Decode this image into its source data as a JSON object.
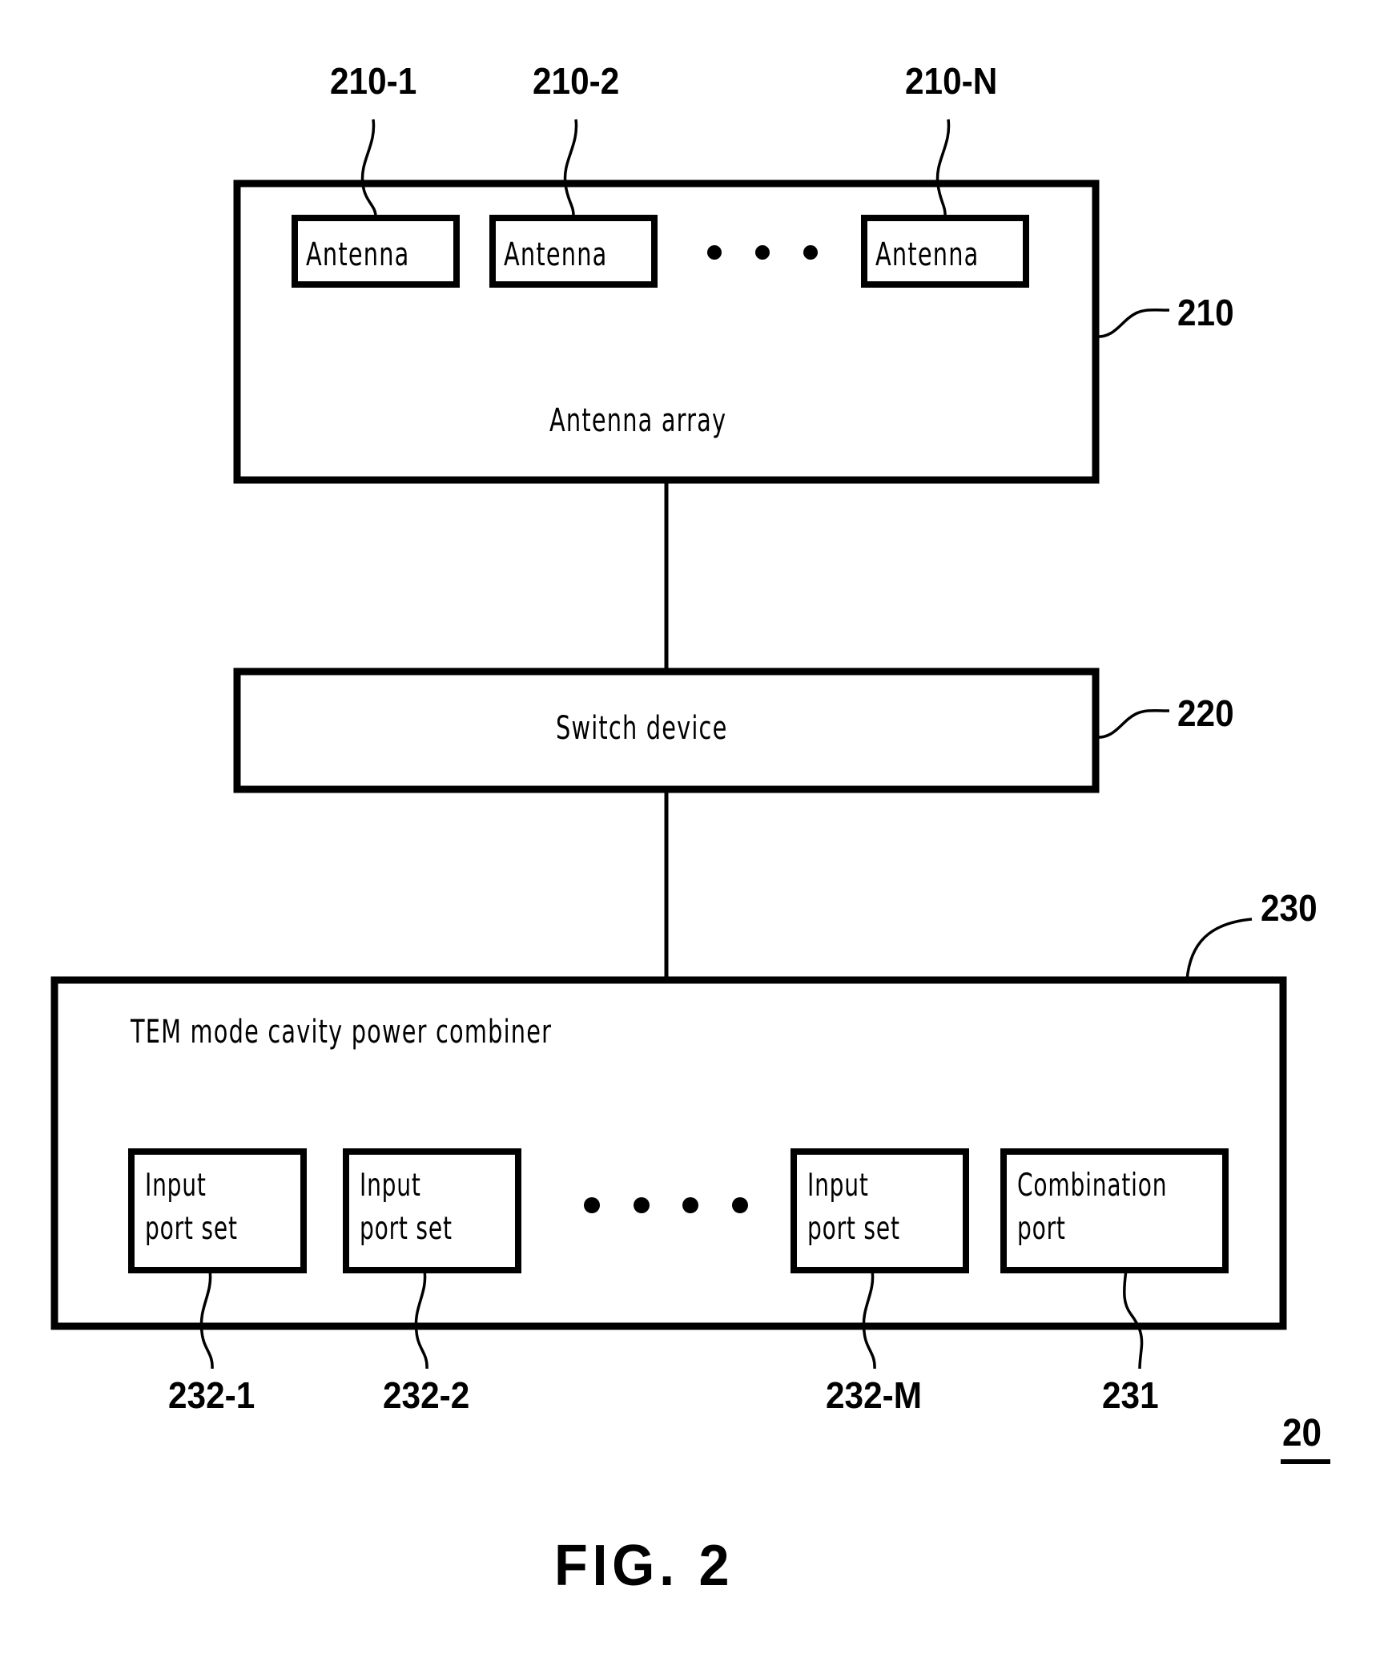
{
  "figure": {
    "caption": "FIG. 2",
    "system_ref": "20"
  },
  "antenna_array": {
    "ref": "210",
    "title": "Antenna array",
    "elements": [
      {
        "label": "Antenna",
        "ref": "210-1"
      },
      {
        "label": "Antenna",
        "ref": "210-2"
      },
      {
        "label": "Antenna",
        "ref": "210-N"
      }
    ],
    "ellipsis_dots": 3
  },
  "switch_device": {
    "ref": "220",
    "title": "Switch device"
  },
  "combiner": {
    "ref": "230",
    "title": "TEM mode cavity power combiner",
    "ports": [
      {
        "line1": "Input",
        "line2": "port set",
        "ref": "232-1"
      },
      {
        "line1": "Input",
        "line2": "port set",
        "ref": "232-2"
      },
      {
        "line1": "Input",
        "line2": "port set",
        "ref": "232-M"
      },
      {
        "line1": "Combination",
        "line2": "port",
        "ref": "231"
      }
    ],
    "ellipsis_dots": 4
  },
  "colors": {
    "ink": "#000000",
    "paper": "#ffffff"
  }
}
